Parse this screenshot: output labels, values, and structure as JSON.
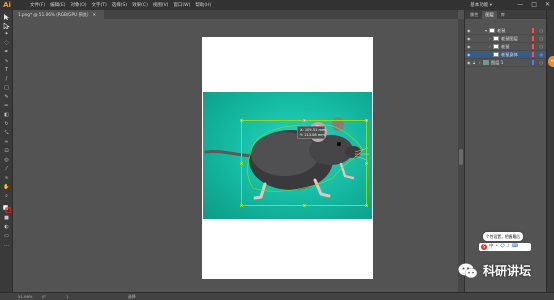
{
  "app": {
    "logo": "Ai"
  },
  "menu": [
    "文件(F)",
    "编辑(E)",
    "对象(O)",
    "文字(T)",
    "选择(S)",
    "效果(C)",
    "视图(V)",
    "窗口(W)",
    "帮助(H)"
  ],
  "workspace_label": "基本功能 ▾",
  "window_buttons": [
    "—",
    "□",
    "✕"
  ],
  "document_tab": {
    "title": "1.png* @ 51.06% (RGB/GPU 预览)",
    "close": "✕"
  },
  "transform_tooltip": {
    "x": "X: 105.51 mm",
    "y": "Y: 113.08 mm"
  },
  "panel": {
    "tabs": [
      "属性",
      "图层",
      "库"
    ],
    "active_tab": "图层",
    "layers": [
      {
        "name": "老鼠",
        "caret": "▾",
        "thumb": "white",
        "tag_color": "#ff4b4b",
        "selected": false
      },
      {
        "name": "老鼠图层",
        "caret": "›",
        "thumb": "white",
        "tag_color": "#ff4b4b",
        "selected": false
      },
      {
        "name": "老鼠",
        "caret": "›",
        "thumb": "white",
        "tag_color": "#ff4b4b",
        "selected": false
      },
      {
        "name": "老鼠身体",
        "caret": "",
        "thumb": "white",
        "tag_color": "#ff4b4b",
        "selected": true
      },
      {
        "name": "图层 1",
        "caret": "›",
        "thumb": "green",
        "tag_color": "#4a7bff",
        "selected": false
      }
    ]
  },
  "status": {
    "zoom": "51.06%",
    "angle": "0°",
    "page": "1",
    "tool": "选择"
  },
  "ime": {
    "tip": "个性设置，把握最后",
    "logo": "S"
  },
  "watermark": {
    "text": "科研讲坛"
  },
  "icons": [
    "selection-tool-icon",
    "pen-tool-icon",
    "type-tool-icon",
    "eye-icon",
    "wechat-icon"
  ]
}
